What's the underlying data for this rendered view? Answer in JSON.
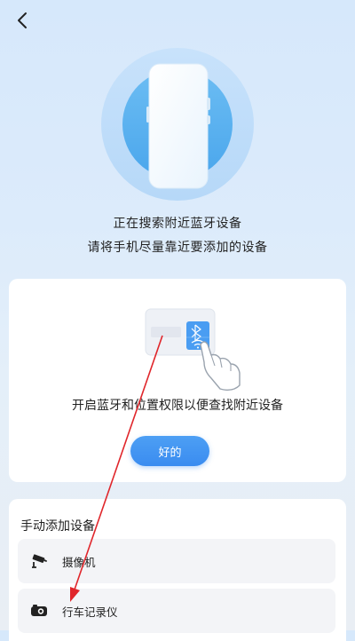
{
  "header": {
    "back_icon": "chevron-left-icon"
  },
  "search": {
    "line1": "正在搜索附近蓝牙设备",
    "line2": "请将手机尽量靠近要添加的设备"
  },
  "permission": {
    "text": "开启蓝牙和位置权限以便查找附近设备",
    "ok_label": "好的",
    "icons": [
      "bluetooth-icon",
      "wifi-icon"
    ]
  },
  "manual": {
    "title": "手动添加设备",
    "items": [
      {
        "label": "摄像机",
        "icon": "security-camera-icon"
      },
      {
        "label": "行车记录仪",
        "icon": "dashcam-icon"
      }
    ]
  },
  "colors": {
    "accent": "#3a8cf0",
    "annotation_arrow": "#e0262b",
    "background_top": "#d6e8fb",
    "card": "#ffffff"
  }
}
